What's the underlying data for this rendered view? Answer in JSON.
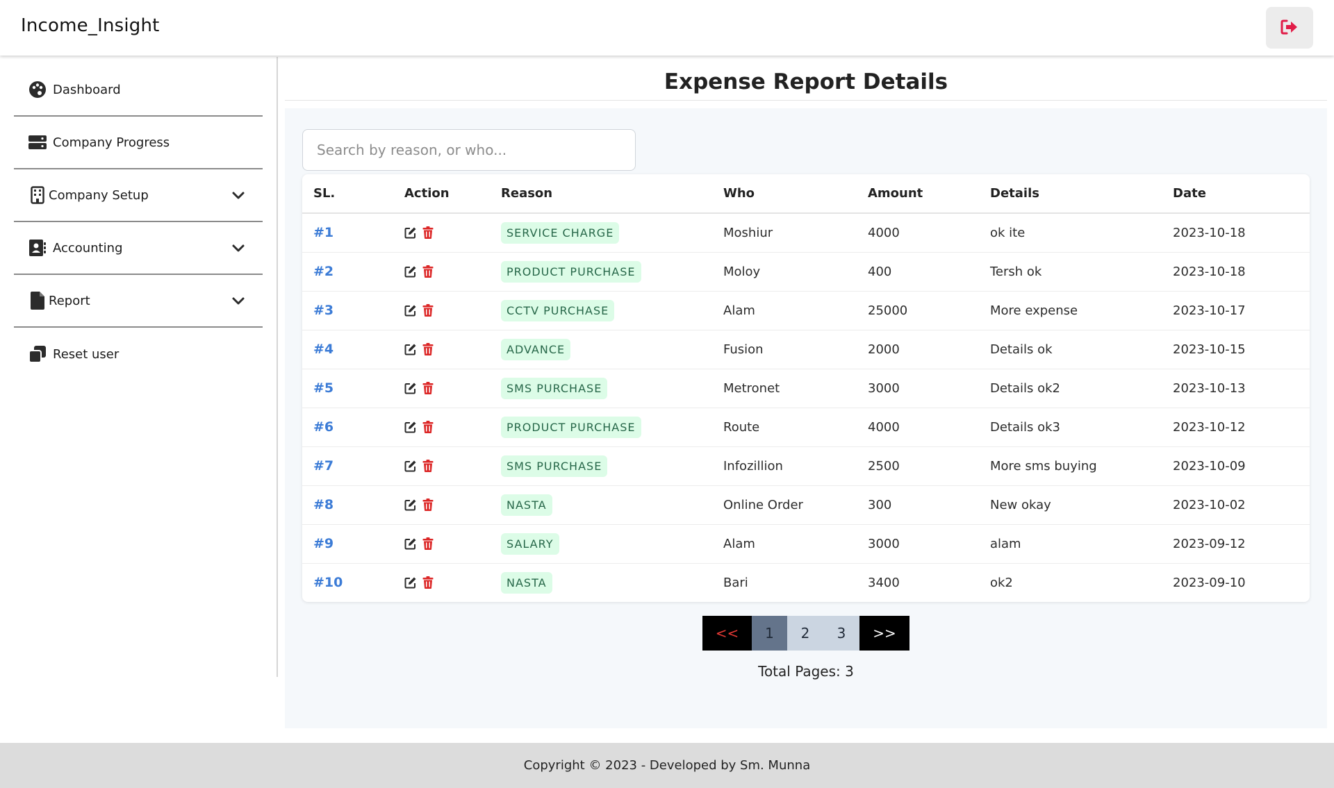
{
  "app": {
    "title": "Income_Insight"
  },
  "colors": {
    "accent_link": "#3b7bd6",
    "badge_bg": "#dcfce7",
    "badge_text": "#276749",
    "delete_red": "#dc2626",
    "logout_red": "#e11d48"
  },
  "sidebar": {
    "items": [
      {
        "label": "Dashboard",
        "icon": "palette-icon",
        "expandable": false
      },
      {
        "label": "Company Progress",
        "icon": "server-icon",
        "expandable": false
      },
      {
        "label": "Company Setup",
        "icon": "building-icon",
        "expandable": true
      },
      {
        "label": "Accounting",
        "icon": "address-book-icon",
        "expandable": true
      },
      {
        "label": "Report",
        "icon": "file-icon",
        "expandable": true
      },
      {
        "label": "Reset user",
        "icon": "copy-icon",
        "expandable": false
      }
    ]
  },
  "page": {
    "title": "Expense Report Details"
  },
  "search": {
    "placeholder": "Search by reason, or who...",
    "value": ""
  },
  "table": {
    "headers": [
      "SL.",
      "Action",
      "Reason",
      "Who",
      "Amount",
      "Details",
      "Date"
    ],
    "rows": [
      {
        "sl": "#1",
        "reason": "SERVICE CHARGE",
        "who": "Moshiur",
        "amount": "4000",
        "details": "ok ite",
        "date": "2023-10-18"
      },
      {
        "sl": "#2",
        "reason": "PRODUCT PURCHASE",
        "who": "Moloy",
        "amount": "400",
        "details": "Tersh ok",
        "date": "2023-10-18"
      },
      {
        "sl": "#3",
        "reason": "CCTV PURCHASE",
        "who": "Alam",
        "amount": "25000",
        "details": "More expense",
        "date": "2023-10-17"
      },
      {
        "sl": "#4",
        "reason": "ADVANCE",
        "who": "Fusion",
        "amount": "2000",
        "details": "Details ok",
        "date": "2023-10-15"
      },
      {
        "sl": "#5",
        "reason": "SMS PURCHASE",
        "who": "Metronet",
        "amount": "3000",
        "details": "Details ok2",
        "date": "2023-10-13"
      },
      {
        "sl": "#6",
        "reason": "PRODUCT PURCHASE",
        "who": "Route",
        "amount": "4000",
        "details": "Details ok3",
        "date": "2023-10-12"
      },
      {
        "sl": "#7",
        "reason": "SMS PURCHASE",
        "who": "Infozillion",
        "amount": "2500",
        "details": "More sms buying",
        "date": "2023-10-09"
      },
      {
        "sl": "#8",
        "reason": "NASTA",
        "who": "Online Order",
        "amount": "300",
        "details": "New okay",
        "date": "2023-10-02"
      },
      {
        "sl": "#9",
        "reason": "SALARY",
        "who": "Alam",
        "amount": "3000",
        "details": "alam",
        "date": "2023-09-12"
      },
      {
        "sl": "#10",
        "reason": "NASTA",
        "who": "Bari",
        "amount": "3400",
        "details": "ok2",
        "date": "2023-09-10"
      }
    ]
  },
  "pagination": {
    "prev_label": "<<",
    "pages": [
      "1",
      "2",
      "3"
    ],
    "current": "1",
    "next_label": ">>",
    "total_text": "Total Pages: 3"
  },
  "footer": {
    "text": "Copyright © 2023 - Developed by Sm. Munna"
  }
}
